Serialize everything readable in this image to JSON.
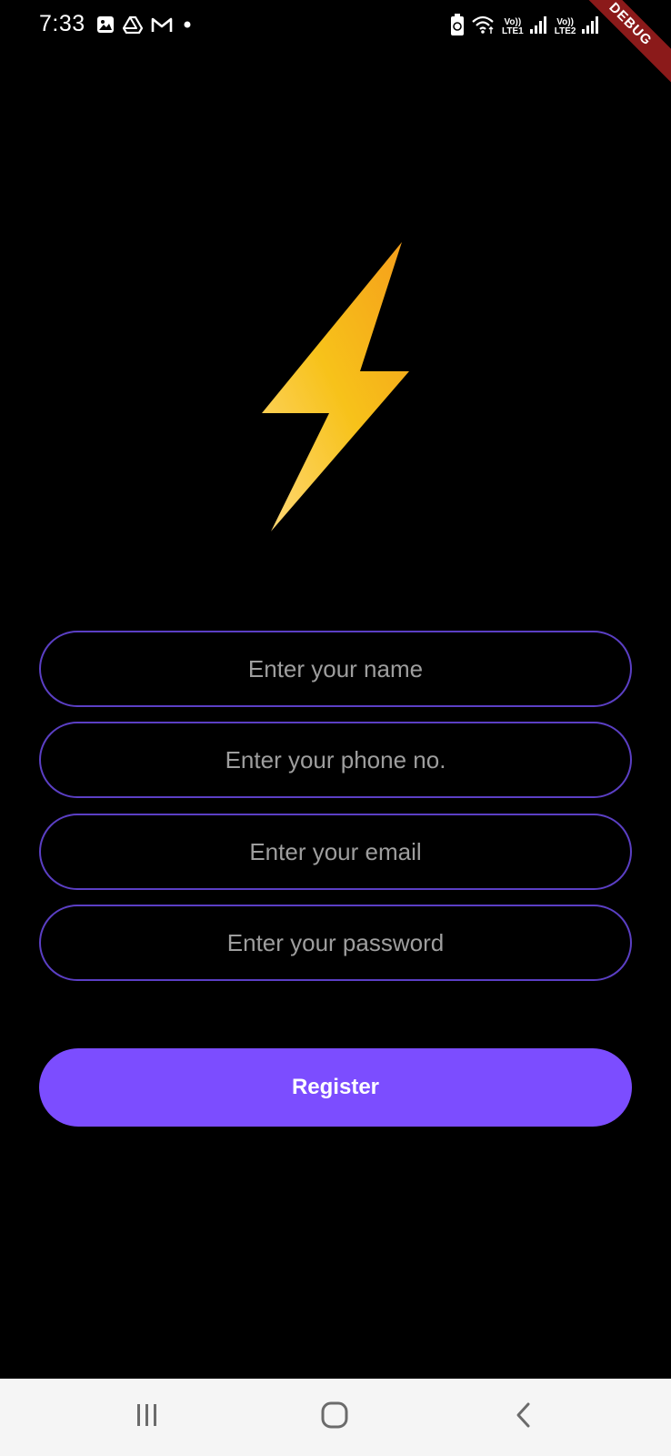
{
  "status_bar": {
    "time": "7:33",
    "left_icons": [
      "gallery-icon",
      "drive-icon",
      "gmail-icon",
      "notification-dot-icon"
    ],
    "right_icons": [
      "battery-saver-icon",
      "wifi-icon",
      "sim1-signal-icon",
      "sim2-signal-icon"
    ],
    "sim1_label_top": "Vo))",
    "sim1_label_bottom": "LTE1",
    "sim2_label_top": "Vo))",
    "sim2_label_bottom": "LTE2"
  },
  "debug_banner": {
    "label": "DEBUG"
  },
  "logo": {
    "icon": "lightning-bolt-icon",
    "gradient_colors": [
      "#f59e1b",
      "#f7c21a",
      "#ffd97a"
    ]
  },
  "form": {
    "name_placeholder": "Enter your name",
    "phone_placeholder": "Enter your phone no.",
    "email_placeholder": "Enter your email",
    "password_placeholder": "Enter your password",
    "border_color": "#5b3fc4"
  },
  "register_button": {
    "label": "Register",
    "color": "#7c4dff"
  },
  "nav_bar": {
    "items": [
      "recent-apps-icon",
      "home-icon",
      "back-icon"
    ]
  }
}
